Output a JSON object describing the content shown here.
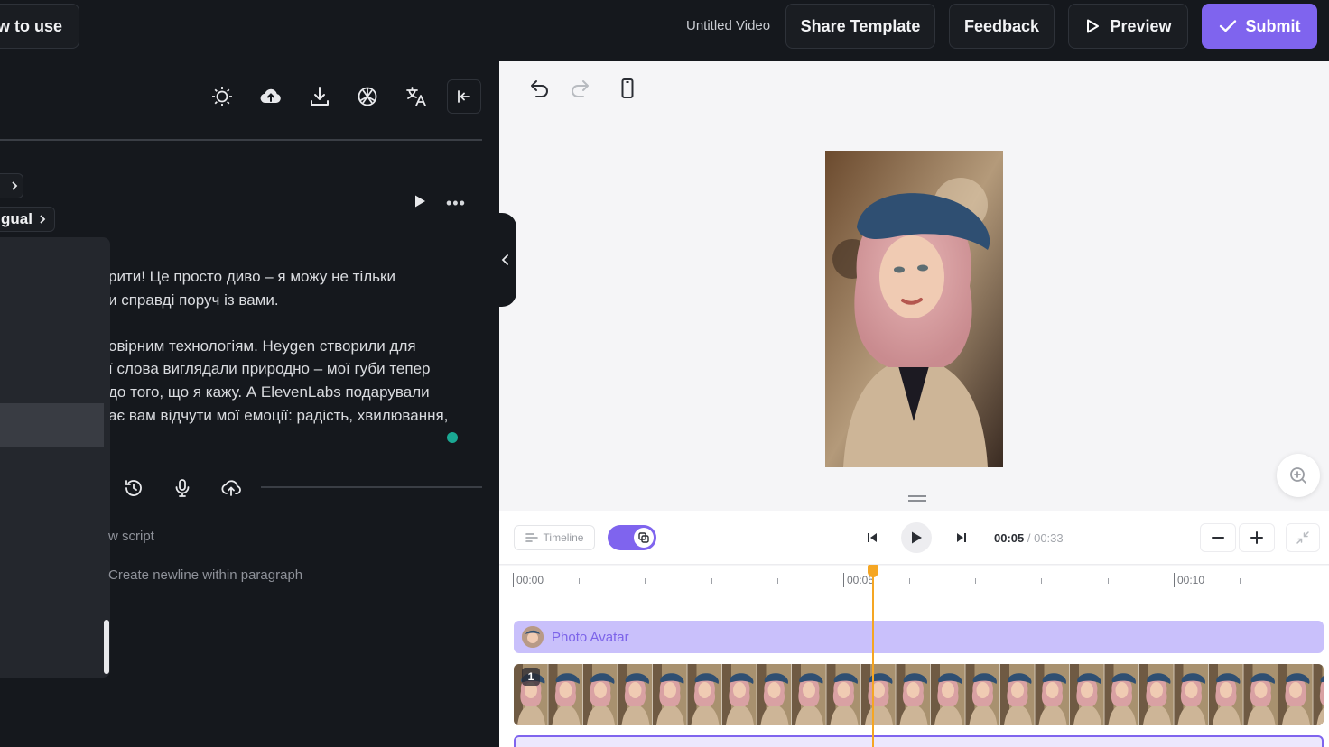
{
  "header": {
    "how_to_use": "w to use",
    "video_title": "Untitled Video",
    "share_template": "Share Template",
    "feedback": "Feedback",
    "preview": "Preview",
    "submit": "Submit"
  },
  "left": {
    "toolbar_icons": [
      "bulb-icon",
      "cloud-upload-icon",
      "download-icon",
      "openai-icon",
      "translate-icon",
      "collapse-left-icon"
    ],
    "chip_top": "",
    "chip_lang": "gual",
    "script_lines": [
      "рити! Це просто диво – я можу не тільки",
      "и справді поруч із вами.",
      "",
      "овірним технологіям. Heygen створили для",
      "ї слова виглядали природно – мої губи тепер",
      "до того, що я кажу. А ElevenLabs подарували",
      "ає вам відчути мої емоції: радість, хвилювання,"
    ],
    "hint_script": "w script",
    "hint_newline": "Create newline within paragraph"
  },
  "timeline": {
    "label": "Timeline",
    "time_current": "00:05",
    "time_sep": " / ",
    "time_total": "00:33",
    "ruler": [
      "00:00",
      "00:05",
      "00:10"
    ],
    "avatar_track": "Photo Avatar",
    "scene_number": "1",
    "playhead_seconds": 5
  },
  "colors": {
    "accent": "#7f64ee",
    "playhead": "#f5a623",
    "dot": "#1aa893"
  }
}
